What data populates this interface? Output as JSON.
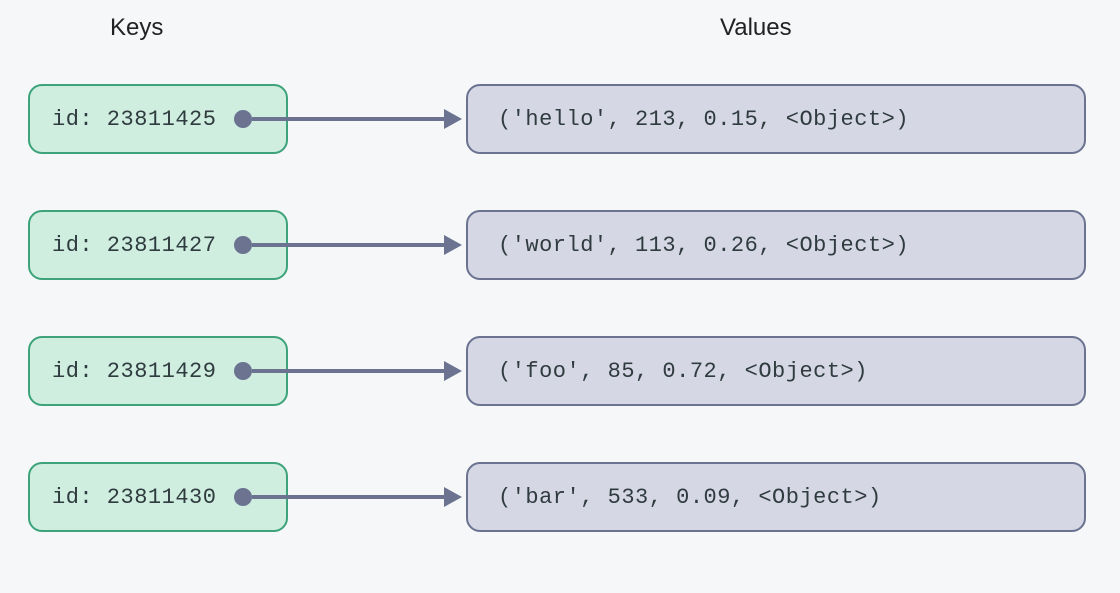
{
  "headers": {
    "keys": "Keys",
    "values": "Values"
  },
  "rows": [
    {
      "key": "id: 23811425",
      "value": "('hello', 213, 0.15, <Object>)"
    },
    {
      "key": "id: 23811427",
      "value": "('world', 113, 0.26, <Object>)"
    },
    {
      "key": "id: 23811429",
      "value": "('foo', 85, 0.72, <Object>)"
    },
    {
      "key": "id: 23811430",
      "value": "('bar', 533, 0.09, <Object>)"
    }
  ]
}
